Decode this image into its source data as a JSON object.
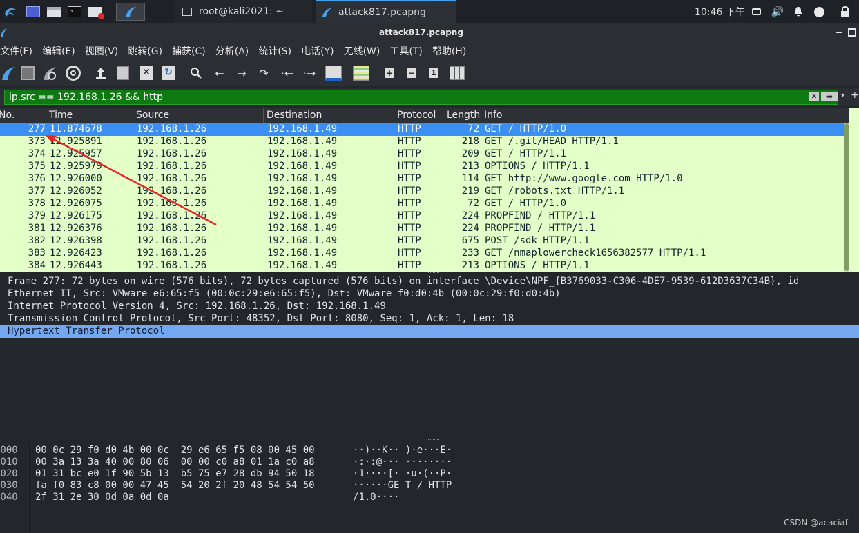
{
  "taskbar": {
    "tasks": [
      {
        "label": "root@kali2021: ~",
        "icon": "terminal-icon"
      },
      {
        "label": "attack817.pcapng",
        "icon": "wireshark-fin-icon"
      }
    ],
    "clock": "10:46 下午"
  },
  "window": {
    "title": "attack817.pcapng"
  },
  "menu": [
    "文件(F)",
    "编辑(E)",
    "视图(V)",
    "跳转(G)",
    "捕获(C)",
    "分析(A)",
    "统计(S)",
    "电话(Y)",
    "无线(W)",
    "工具(T)",
    "帮助(H)"
  ],
  "filter": {
    "value": "ip.src == 192.168.1.26 && http"
  },
  "packet_list": {
    "columns": [
      "No.",
      "Time",
      "Source",
      "Destination",
      "Protocol",
      "Length",
      "Info"
    ],
    "rows": [
      {
        "no": "277",
        "time": "11.874678",
        "src": "192.168.1.26",
        "dst": "192.168.1.49",
        "proto": "HTTP",
        "len": "72",
        "info": "GET / HTTP/1.0",
        "selected": true
      },
      {
        "no": "373",
        "time": "12.925891",
        "src": "192.168.1.26",
        "dst": "192.168.1.49",
        "proto": "HTTP",
        "len": "218",
        "info": "GET /.git/HEAD HTTP/1.1"
      },
      {
        "no": "374",
        "time": "12.925957",
        "src": "192.168.1.26",
        "dst": "192.168.1.49",
        "proto": "HTTP",
        "len": "209",
        "info": "GET / HTTP/1.1"
      },
      {
        "no": "375",
        "time": "12.925979",
        "src": "192.168.1.26",
        "dst": "192.168.1.49",
        "proto": "HTTP",
        "len": "213",
        "info": "OPTIONS / HTTP/1.1"
      },
      {
        "no": "376",
        "time": "12.926000",
        "src": "192.168.1.26",
        "dst": "192.168.1.49",
        "proto": "HTTP",
        "len": "114",
        "info": "GET http://www.google.com HTTP/1.0"
      },
      {
        "no": "377",
        "time": "12.926052",
        "src": "192.168.1.26",
        "dst": "192.168.1.49",
        "proto": "HTTP",
        "len": "219",
        "info": "GET /robots.txt HTTP/1.1"
      },
      {
        "no": "378",
        "time": "12.926075",
        "src": "192.168.1.26",
        "dst": "192.168.1.49",
        "proto": "HTTP",
        "len": "72",
        "info": "GET / HTTP/1.0"
      },
      {
        "no": "379",
        "time": "12.926175",
        "src": "192.168.1.26",
        "dst": "192.168.1.49",
        "proto": "HTTP",
        "len": "224",
        "info": "PROPFIND / HTTP/1.1"
      },
      {
        "no": "381",
        "time": "12.926376",
        "src": "192.168.1.26",
        "dst": "192.168.1.49",
        "proto": "HTTP",
        "len": "224",
        "info": "PROPFIND / HTTP/1.1"
      },
      {
        "no": "382",
        "time": "12.926398",
        "src": "192.168.1.26",
        "dst": "192.168.1.49",
        "proto": "HTTP",
        "len": "675",
        "info": "POST /sdk HTTP/1.1"
      },
      {
        "no": "383",
        "time": "12.926423",
        "src": "192.168.1.26",
        "dst": "192.168.1.49",
        "proto": "HTTP",
        "len": "233",
        "info": "GET /nmaplowercheck1656382577 HTTP/1.1"
      },
      {
        "no": "384",
        "time": "12.926443",
        "src": "192.168.1.26",
        "dst": "192.168.1.49",
        "proto": "HTTP",
        "len": "213",
        "info": "OPTIONS / HTTP/1.1"
      }
    ]
  },
  "details": [
    {
      "text": "Frame 277: 72 bytes on wire (576 bits), 72 bytes captured (576 bits) on interface \\Device\\NPF_{B3769033-C306-4DE7-9539-612D3637C34B}, id"
    },
    {
      "text": "Ethernet II, Src: VMware_e6:65:f5 (00:0c:29:e6:65:f5), Dst: VMware_f0:d0:4b (00:0c:29:f0:d0:4b)"
    },
    {
      "text": "Internet Protocol Version 4, Src: 192.168.1.26, Dst: 192.168.1.49"
    },
    {
      "text": "Transmission Control Protocol, Src Port: 48352, Dst Port: 8080, Seq: 1, Ack: 1, Len: 18"
    },
    {
      "text": "Hypertext Transfer Protocol",
      "selected": true
    }
  ],
  "hex": [
    {
      "offset": "0000",
      "bytes": "00 0c 29 f0 d0 4b 00 0c  29 e6 65 f5 08 00 45 00",
      "ascii": "··)··K·· )·e···E·"
    },
    {
      "offset": "0010",
      "bytes": "00 3a 13 3a 40 00 80 06  00 00 c0 a8 01 1a c0 a8",
      "ascii": "·:·:@··· ········"
    },
    {
      "offset": "0020",
      "bytes": "01 31 bc e0 1f 90 5b 13  b5 75 e7 28 db 94 50 18",
      "ascii": "·1····[· ·u·(··P·"
    },
    {
      "offset": "0030",
      "bytes": "fa f0 83 c8 00 00 47 45  54 20 2f 20 48 54 54 50",
      "ascii": "······GE T / HTTP"
    },
    {
      "offset": "0040",
      "bytes": "2f 31 2e 30 0d 0a 0d 0a",
      "ascii": "/1.0····"
    }
  ],
  "watermark": "CSDN @acaciaf",
  "colors": {
    "selected_row": "#3b8ff2",
    "http_row": "#e4ffc7",
    "filter_valid": "#0c7a10",
    "arrow": "#e0282a"
  }
}
